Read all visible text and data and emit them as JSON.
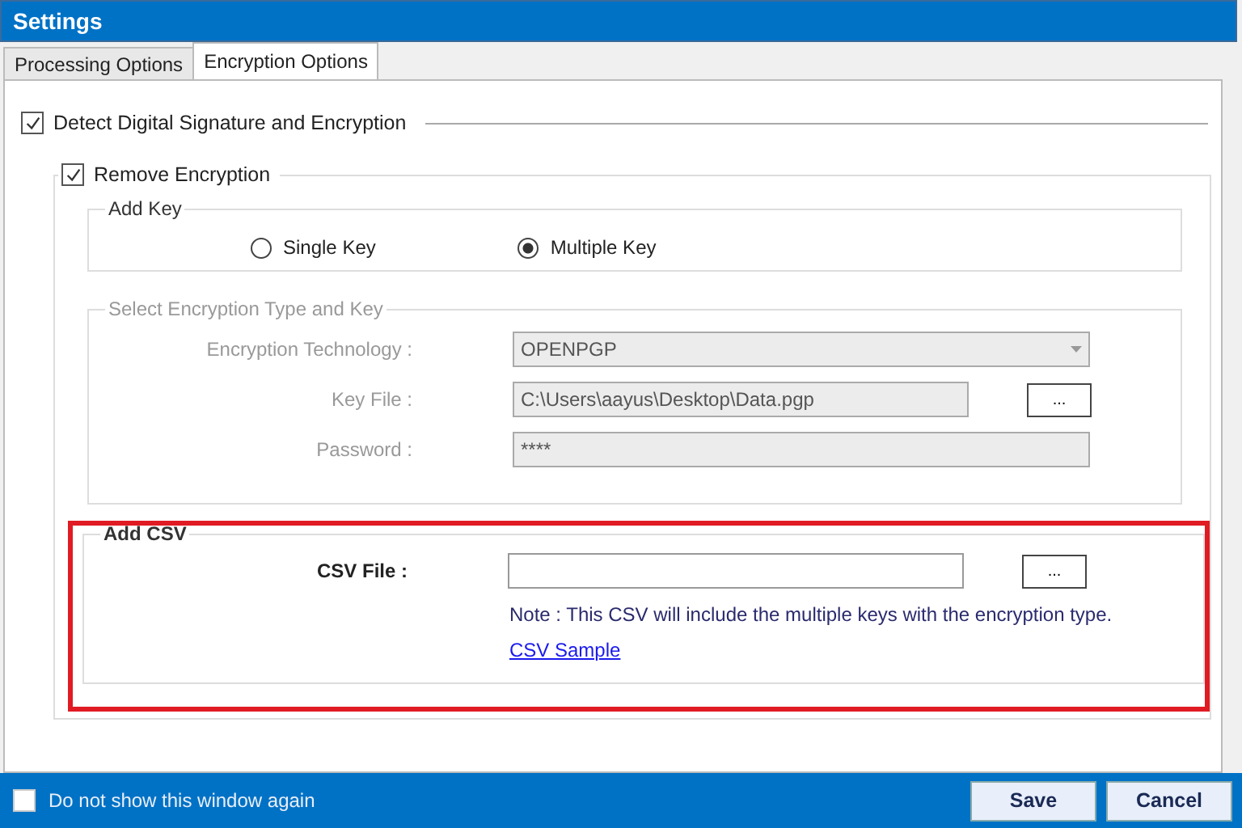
{
  "window": {
    "title": "Settings"
  },
  "tabs": [
    {
      "label": "Processing Options",
      "selected": false
    },
    {
      "label": "Encryption Options",
      "selected": true
    }
  ],
  "detect": {
    "label": "Detect Digital Signature and Encryption",
    "checked": true
  },
  "remove": {
    "label": "Remove Encryption",
    "checked": true
  },
  "add_key": {
    "title": "Add Key",
    "options": [
      {
        "label": "Single Key",
        "selected": false
      },
      {
        "label": "Multiple Key",
        "selected": true
      }
    ]
  },
  "encryption": {
    "title": "Select Encryption Type and Key",
    "disabled": true,
    "fields": [
      {
        "kind": "select",
        "label": "Encryption Technology :",
        "value": "OPENPGP"
      },
      {
        "kind": "file",
        "label": "Key File  :",
        "value": "C:\\Users\\aayus\\Desktop\\Data.pgp",
        "browse": "..."
      },
      {
        "kind": "password",
        "label": "Password :",
        "value": "****"
      }
    ]
  },
  "add_csv": {
    "title": "Add CSV",
    "highlighted": true,
    "label": "CSV File :",
    "browse": "...",
    "note": "Note : This CSV will include the multiple keys with the encryption type.",
    "link": "CSV Sample"
  },
  "footer": {
    "checkbox": {
      "label": "Do not show this window again",
      "checked": false
    },
    "buttons": [
      "Save",
      "Cancel"
    ]
  }
}
